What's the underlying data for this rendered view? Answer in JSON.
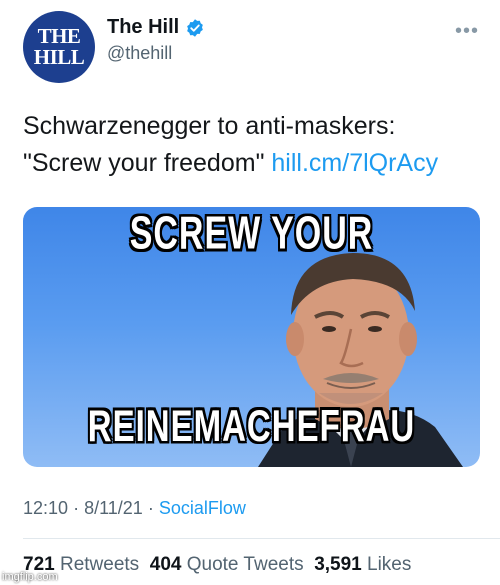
{
  "account": {
    "avatar_line1": "THE",
    "avatar_line2": "HILL",
    "display_name": "The Hill",
    "handle": "@thehill",
    "verified": true,
    "brand_color": "#1d3f8f"
  },
  "tweet": {
    "text_line1": "Schwarzenegger to anti-maskers:",
    "text_line2": "\"Screw your freedom\"",
    "link": "hill.cm/7lQrAcy",
    "link_color": "#1d9bf0"
  },
  "media": {
    "caption_top": "SCREW  YOUR",
    "caption_bottom": "REINEMACHEFRAU"
  },
  "meta": {
    "time": "12:10",
    "separator": "·",
    "date": "8/11/21",
    "source": "SocialFlow"
  },
  "stats": {
    "retweets_count": "721",
    "retweets_label": "Retweets",
    "quotes_count": "404",
    "quotes_label": "Quote Tweets",
    "likes_count": "3,591",
    "likes_label": "Likes"
  },
  "watermark": "imgflip.com",
  "icons": {
    "verified": "verified-badge-icon",
    "more": "more-options-icon"
  }
}
